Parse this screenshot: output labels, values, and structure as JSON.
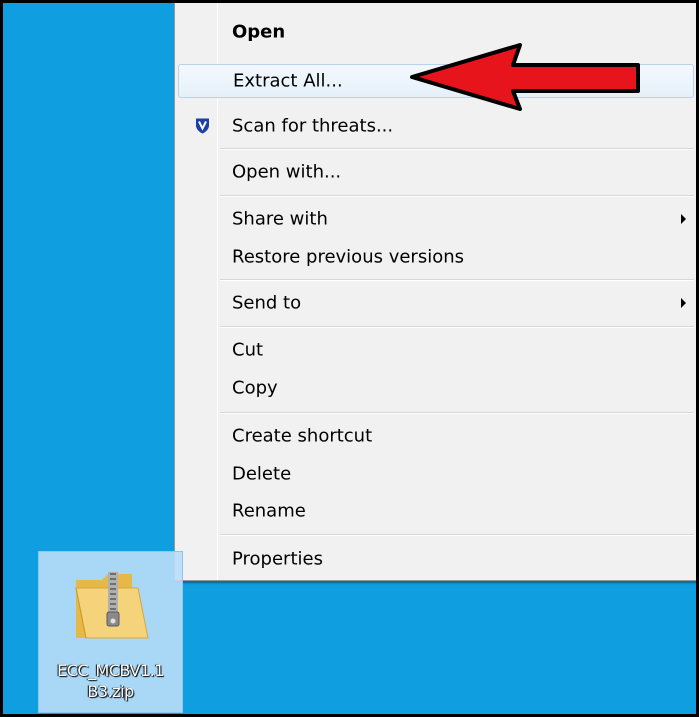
{
  "context_menu": {
    "items": [
      {
        "label": "Open",
        "bold": true
      },
      {
        "label": "Extract All...",
        "highlighted": true
      },
      {
        "label": "Scan for threats...",
        "icon": "shield-icon"
      },
      {
        "label": "Open with..."
      },
      {
        "label": "Share with",
        "submenu": true
      },
      {
        "label": "Restore previous versions"
      },
      {
        "label": "Send to",
        "submenu": true
      },
      {
        "label": "Cut"
      },
      {
        "label": "Copy"
      },
      {
        "label": "Create shortcut"
      },
      {
        "label": "Delete"
      },
      {
        "label": "Rename"
      },
      {
        "label": "Properties"
      }
    ]
  },
  "desktop_file": {
    "name_line1": "ECC_MCBV1.1",
    "name_line2": "B3.zip",
    "icon": "zip-folder-icon"
  },
  "annotation": {
    "icon": "red-arrow-icon",
    "color": "#e8141c"
  },
  "colors": {
    "desktop": "#0f9ee0",
    "menu_bg": "#f1f1f1",
    "highlight_border": "#b8d2ec",
    "shield": "#1b3fa6"
  }
}
